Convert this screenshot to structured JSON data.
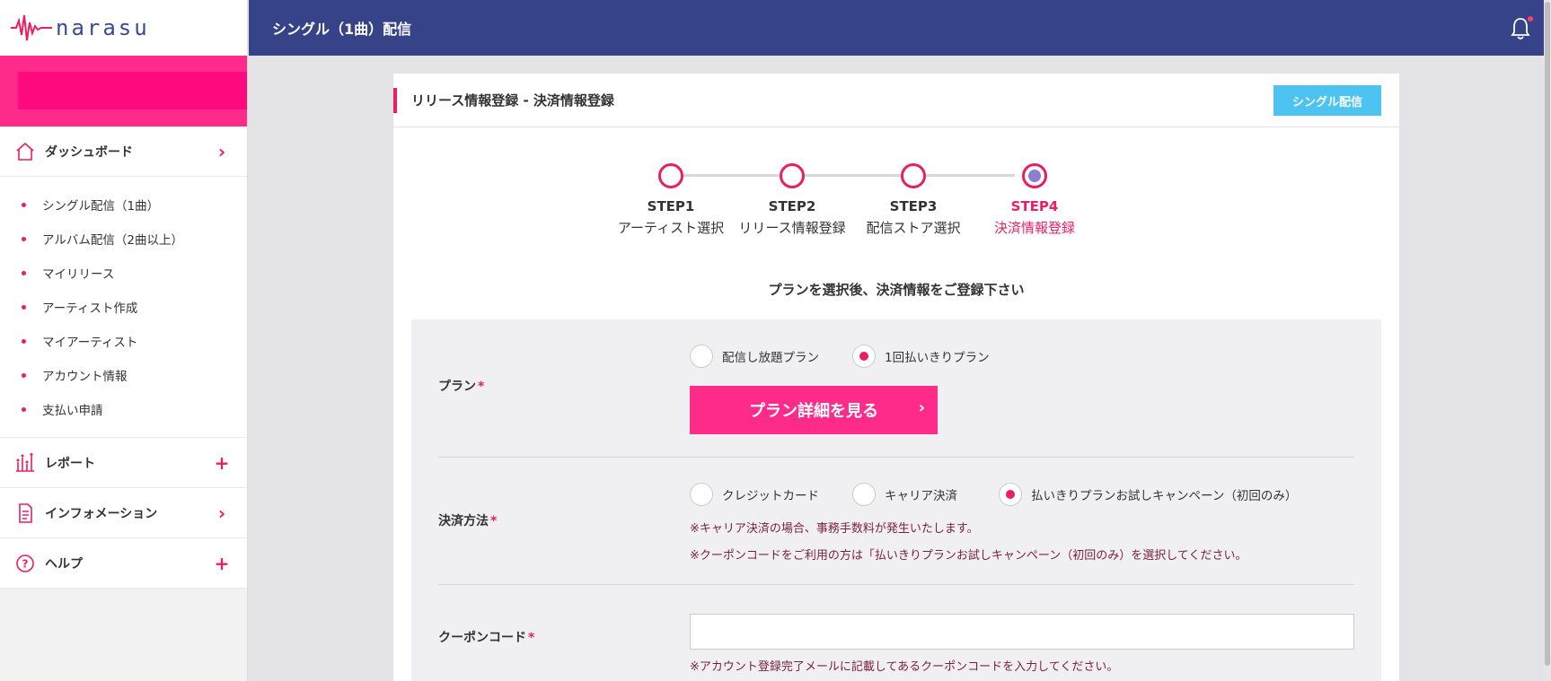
{
  "app": {
    "logo_text": "narasu"
  },
  "header": {
    "title": "シングル（1曲）配信"
  },
  "sidebar": {
    "dashboard": {
      "label": "ダッシュボード",
      "icon": "home-icon"
    },
    "submenu": [
      "シングル配信（1曲）",
      "アルバム配信（2曲以上）",
      "マイリリース",
      "アーティスト作成",
      "マイアーティスト",
      "アカウント情報",
      "支払い申請"
    ],
    "report": {
      "label": "レポート",
      "icon": "chart-icon"
    },
    "information": {
      "label": "インフォメーション",
      "icon": "document-icon"
    },
    "help": {
      "label": "ヘルプ",
      "icon": "help-icon"
    }
  },
  "card": {
    "title": "リリース情報登録 - 決済情報登録",
    "tag_button": "シングル配信"
  },
  "steps": [
    {
      "num": "STEP1",
      "name": "アーティスト選択",
      "active": false
    },
    {
      "num": "STEP2",
      "name": "リリース情報登録",
      "active": false
    },
    {
      "num": "STEP3",
      "name": "配信ストア選択",
      "active": false
    },
    {
      "num": "STEP4",
      "name": "決済情報登録",
      "active": true
    }
  ],
  "instruction": "プランを選択後、決済情報をご登録下さい",
  "form": {
    "plan": {
      "label": "プラン",
      "required_mark": "*",
      "options": [
        "配信し放題プラン",
        "1回払いきりプラン"
      ],
      "selected": 1,
      "detail_button": "プラン詳細を見る"
    },
    "payment": {
      "label": "決済方法",
      "required_mark": "*",
      "options": [
        "クレジットカード",
        "キャリア決済",
        "払いきりプランお試しキャンペーン（初回のみ）"
      ],
      "selected": 2,
      "note1": "※キャリア決済の場合、事務手数料が発生いたします。",
      "note2": "※クーポンコードをご利用の方は「払いきりプランお試しキャンペーン（初回のみ）を選択してください。"
    },
    "coupon": {
      "label": "クーポンコード",
      "required_mark": "*",
      "value": "",
      "placeholder": "",
      "note": "※アカウント登録完了メールに記載してあるクーポンコードを入力してください。"
    }
  },
  "colors": {
    "primary": "#364389",
    "accent": "#e91e63",
    "pink": "#ff2b8a",
    "info": "#4cc3f0"
  }
}
